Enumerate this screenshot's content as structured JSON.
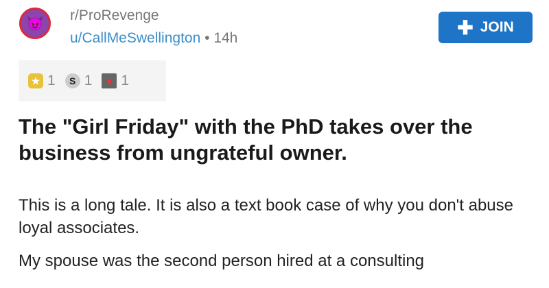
{
  "post": {
    "subreddit": "r/ProRevenge",
    "author": "u/CallMeSwellington",
    "separator": "•",
    "age": "14h",
    "join_label": "JOIN",
    "awards": [
      {
        "icon": "gold-star-award-icon",
        "count": "1"
      },
      {
        "icon": "silver-s-award-icon",
        "count": "1"
      },
      {
        "icon": "image-award-icon",
        "count": "1"
      }
    ],
    "title": "The \"Girl Friday\" with the PhD takes over the business from ungrateful owner.",
    "paragraphs": [
      "This is a long tale. It is also a text book case of why you don't abuse loyal associates.",
      "My spouse was the second person hired at a consulting"
    ]
  },
  "colors": {
    "accent": "#1e74c6",
    "link": "#3d8ec9"
  }
}
